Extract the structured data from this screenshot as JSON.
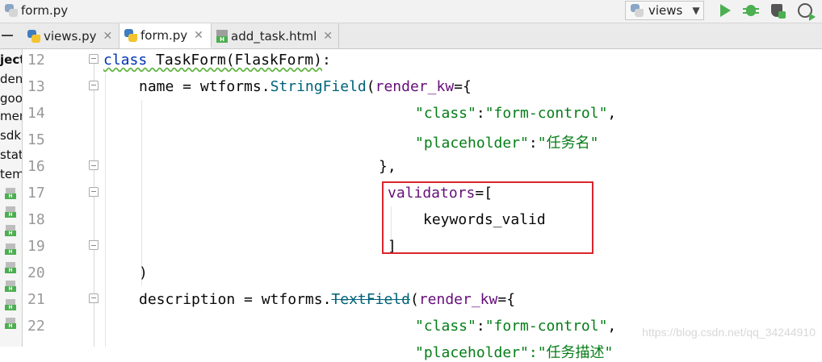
{
  "toolbar": {
    "file_name": "form.py",
    "run_config": "views",
    "icons": [
      "python-file-icon",
      "run-icon",
      "debug-icon",
      "coverage-icon",
      "profile-icon"
    ]
  },
  "tabs": [
    {
      "label": "views.py",
      "active": false
    },
    {
      "label": "form.py",
      "active": true
    },
    {
      "label": "add_task.html",
      "active": false
    }
  ],
  "project": {
    "items": [
      "ject",
      "den",
      "goo",
      "mer",
      "sdk",
      "stat",
      "tem"
    ]
  },
  "editor": {
    "line_numbers": [
      "12",
      "13",
      "14",
      "15",
      "16",
      "17",
      "18",
      "19",
      "20",
      "21",
      "22"
    ]
  },
  "code": {
    "l12_kw": "class",
    "l12_name": " TaskForm(FlaskForm)",
    "l12_colon": ":",
    "l13_var": "name = wtforms.",
    "l13_fn": "StringField",
    "l13_open": "(",
    "l13_prm": "render_kw",
    "l13_eq": "={",
    "l14_key": "\"class\"",
    "l14_colon": ":",
    "l14_val": "\"form-control\"",
    "l14_comma": ",",
    "l15_key": "\"placeholder\"",
    "l15_colon": ":",
    "l15_val": "\"任务名\"",
    "l16_close": "},",
    "l17_prm": "validators",
    "l17_eq": "=[",
    "l18_val": "keywords_valid",
    "l19_close": "]",
    "l20_close": ")",
    "l21_var": "description = wtforms.",
    "l21_fn": "TextField",
    "l21_open": "(",
    "l21_prm": "render_kw",
    "l21_eq": "={",
    "l22_key": "\"class\"",
    "l22_colon": ":",
    "l22_val": "\"form-control\"",
    "l22_comma": ",",
    "l23_partial": "\"placeholder\":\"任务描述\""
  },
  "watermark": "https://blog.csdn.net/qq_34244910",
  "colors": {
    "keyword": "#0033b3",
    "function": "#00627a",
    "param": "#660e7a",
    "string": "#067d17",
    "highlight_box": "#d9262c"
  }
}
